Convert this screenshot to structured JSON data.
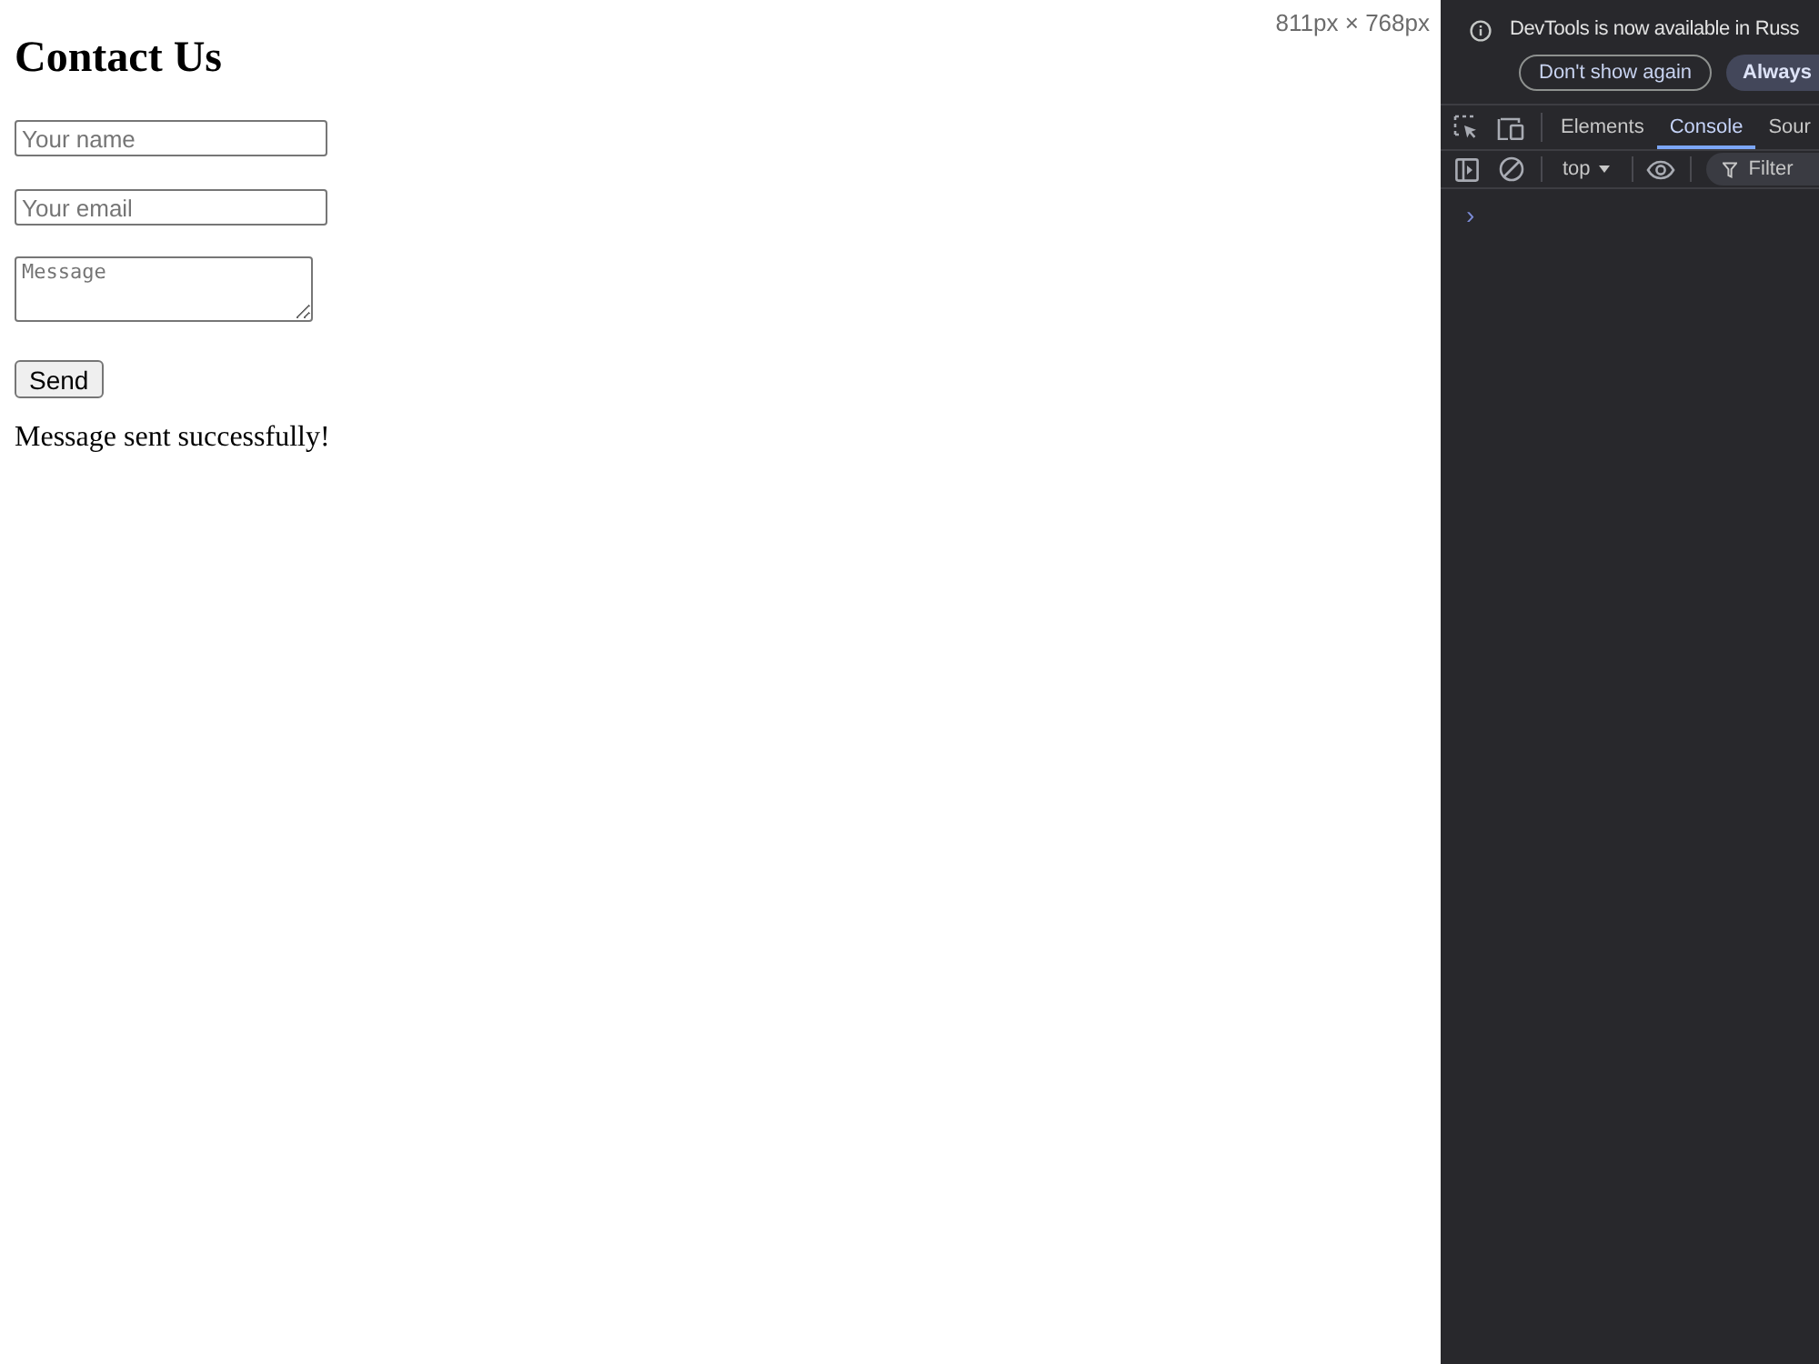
{
  "viewport_size": "811px × 768px",
  "page": {
    "heading": "Contact Us",
    "fields": [
      {
        "kind": "input",
        "placeholder": "Your name"
      },
      {
        "kind": "input",
        "placeholder": "Your email"
      },
      {
        "kind": "textarea",
        "placeholder": "Message"
      }
    ],
    "submit_button": "Send",
    "status_message": "Message sent successfully!"
  },
  "devtools": {
    "notice": {
      "text": "DevTools is now available in Russ",
      "buttons": [
        {
          "kind": "outline",
          "label": "Don't show again"
        },
        {
          "kind": "filled",
          "label": "Always"
        }
      ]
    },
    "tabs": [
      {
        "label": "Elements",
        "selected": false
      },
      {
        "label": "Console",
        "selected": true
      },
      {
        "label": "Sour",
        "selected": false
      }
    ],
    "toolbar": {
      "context": "top",
      "filter_placeholder": "Filter"
    },
    "console_prompt": "›"
  }
}
